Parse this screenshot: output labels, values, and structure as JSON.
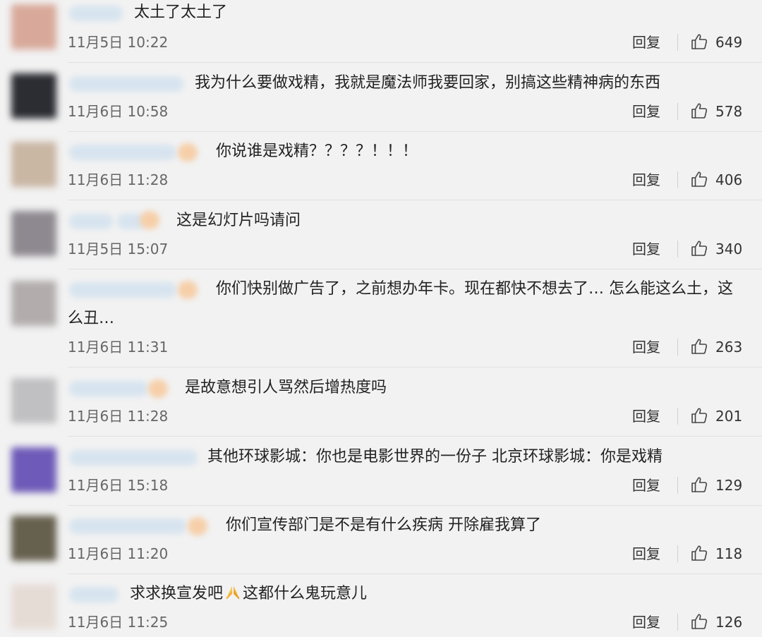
{
  "reply_label": "回复",
  "colors": {
    "background": "#f2f2f2",
    "text": "#222222",
    "meta": "#666666",
    "divider": "#e1e1e1"
  },
  "comments": [
    {
      "text": "太土了太土了",
      "time": "11月5日 10:22",
      "likes": "649"
    },
    {
      "text": "我为什么要做戏精，我就是魔法师我要回家，别搞这些精神病的东西",
      "time": "11月6日 10:58",
      "likes": "578"
    },
    {
      "text": "你说谁是戏精？？？？！！！",
      "time": "11月6日 11:28",
      "likes": "406"
    },
    {
      "text": "这是幻灯片吗请问",
      "time": "11月5日 15:07",
      "likes": "340"
    },
    {
      "text_line1": "你们快别做广告了，之前想办年卡。现在都快不想去了… 怎么能这么土，这",
      "text_line2": "么丑…",
      "time": "11月6日 11:31",
      "likes": "263"
    },
    {
      "text": "是故意想引人骂然后增热度吗",
      "time": "11月6日 11:28",
      "likes": "201"
    },
    {
      "text": "其他环球影城：你也是电影世界的一份子 北京环球影城：你是戏精",
      "time": "11月6日 15:18",
      "likes": "129"
    },
    {
      "text": "你们宣传部门是不是有什么疾病 开除雇我算了",
      "time": "11月6日 11:20",
      "likes": "118"
    },
    {
      "text_before": "求求换宣发吧",
      "emoji": "folded-hands",
      "text_after": "这都什么鬼玩意儿",
      "time": "11月6日 11:25",
      "likes": "126"
    }
  ]
}
